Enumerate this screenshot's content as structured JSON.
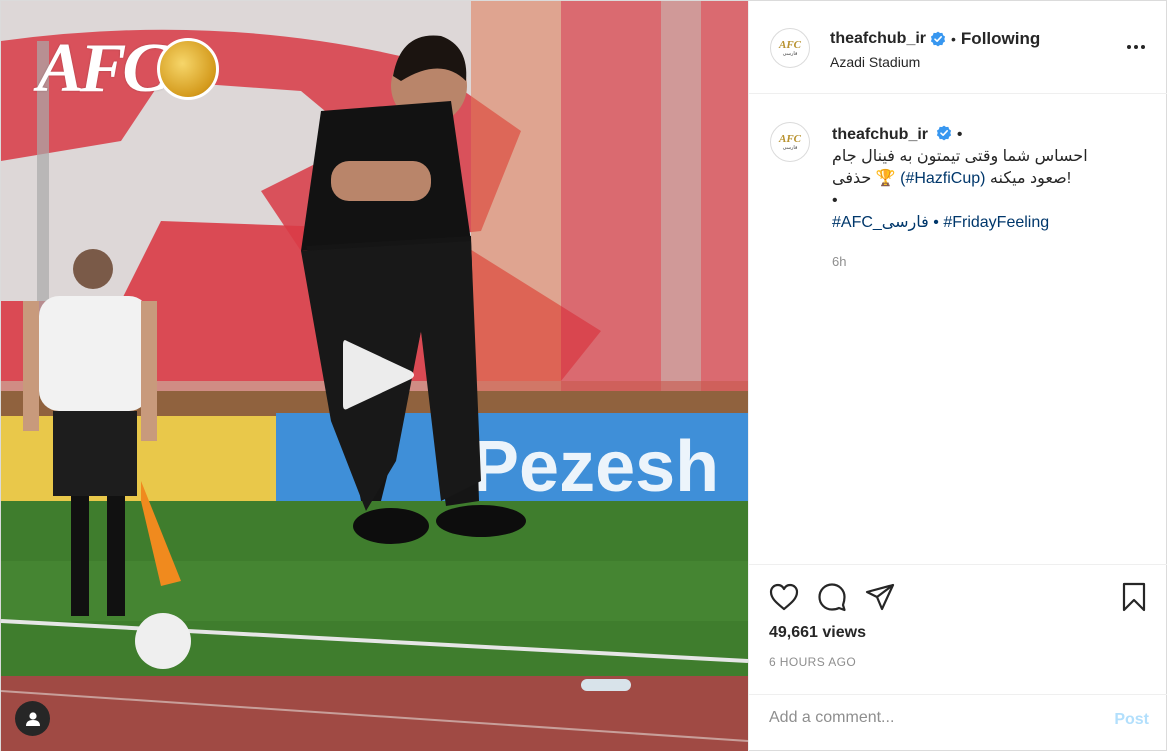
{
  "media": {
    "logo_text": "AFC",
    "play_icon": "play-icon",
    "user_tag_icon": "user-icon",
    "banner_text": "Pezesh"
  },
  "header": {
    "username": "theafchub_ir",
    "separator": "•",
    "follow_label": "Following",
    "location": "Azadi Stadium",
    "avatar_text": "AFC",
    "avatar_subtext": "فارسی",
    "more_icon": "more-horizontal-icon",
    "verified_icon": "verified-badge-icon"
  },
  "caption": {
    "username": "theafchub_ir",
    "separator": "•",
    "line1": "احساس شما وقتی تیمتون به فینال جام",
    "line2_text": "حذفی",
    "line2_emoji": "🏆",
    "line2_hashtag": "(#HazfiCup)",
    "line2_end": "صعود میکنه!",
    "line3": "•",
    "hashtag_afc": "#AFC_فارسی",
    "hashtag_sep": "•",
    "hashtag_friday": "#FridayFeeling",
    "time": "6h"
  },
  "actions": {
    "like_icon": "heart-icon",
    "comment_icon": "comment-icon",
    "share_icon": "share-icon",
    "save_icon": "bookmark-icon",
    "views": "49,661 views",
    "posted_ago": "6 HOURS AGO"
  },
  "comment": {
    "placeholder": "Add a comment...",
    "post_label": "Post"
  },
  "colors": {
    "link": "#00376b",
    "verified": "#3897f0",
    "post_disabled": "#b2dffc",
    "muted": "#8e8e8e"
  }
}
